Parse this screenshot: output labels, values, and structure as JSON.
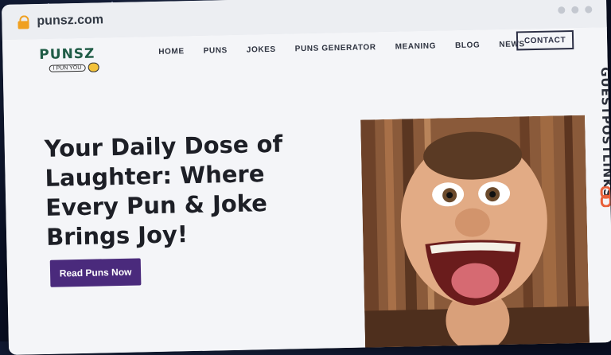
{
  "browser": {
    "url": "punsz.com"
  },
  "logo": {
    "name": "PUNSZ",
    "tagline": "I PUN YOU"
  },
  "nav": {
    "items": [
      "HOME",
      "PUNS",
      "JOKES",
      "PUNS GENERATOR",
      "MEANING",
      "BLOG",
      "NEWS"
    ],
    "contact": "CONTACT"
  },
  "hero": {
    "title": "Your Daily Dose of Laughter: Where Every Pun & Joke Brings Joy!",
    "cta": "Read Puns Now"
  },
  "watermark": {
    "text": "GUESTPOSTLINKS"
  },
  "colors": {
    "accent": "#4a2a7c",
    "logo": "#1f5c46",
    "watermark_icon": "#e8603a"
  }
}
